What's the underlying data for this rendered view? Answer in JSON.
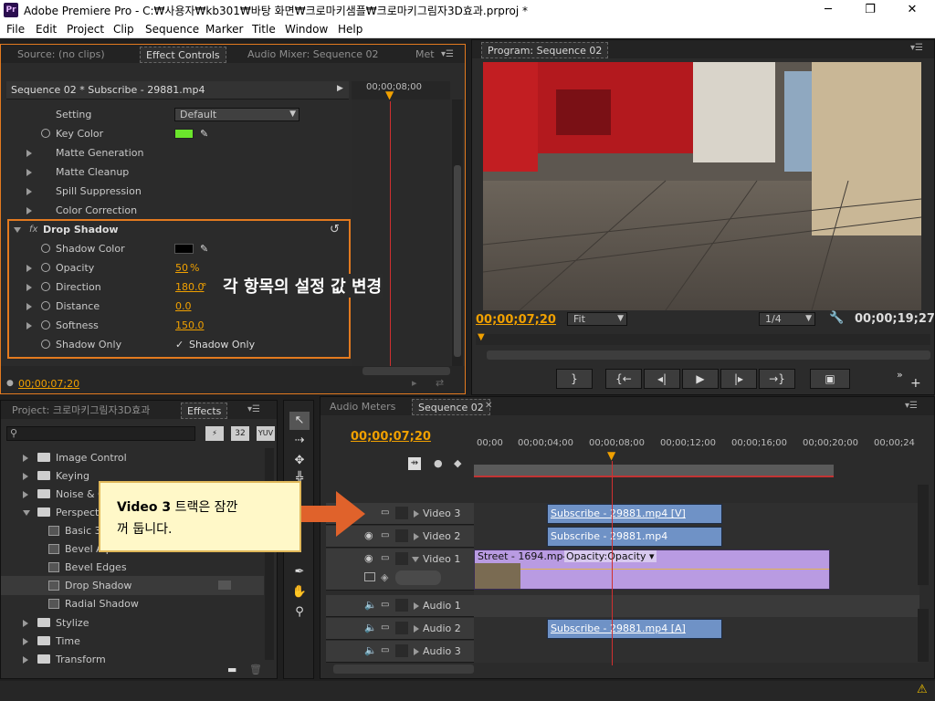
{
  "window": {
    "app_icon": "Pr",
    "title": "Adobe Premiere Pro - C:₩사용자₩kb301₩바탕 화면₩크로마키샘플₩크로마키그림자3D효과.prproj *",
    "minimize": "─",
    "maximize": "❐",
    "close": "✕"
  },
  "menu": [
    "File",
    "Edit",
    "Project",
    "Clip",
    "Sequence",
    "Marker",
    "Title",
    "Window",
    "Help"
  ],
  "top_left_panel": {
    "tabs": [
      "Source: (no clips)",
      "Effect Controls",
      "Audio Mixer: Sequence 02",
      "Met"
    ],
    "clip_header": "Sequence 02 * Subscribe - 29881.mp4",
    "ruler_time": "00;00;08;00",
    "rows": {
      "setting_label": "Setting",
      "setting_value": "Default",
      "key_color": "Key Color",
      "matte_generation": "Matte Generation",
      "matte_cleanup": "Matte Cleanup",
      "spill_suppression": "Spill Suppression",
      "color_correction": "Color Correction",
      "drop_shadow": "Drop Shadow",
      "shadow_color": "Shadow Color",
      "opacity_label": "Opacity",
      "opacity_value": "50",
      "opacity_unit": "%",
      "direction_label": "Direction",
      "direction_value": "180.0",
      "direction_unit": "°",
      "distance_label": "Distance",
      "distance_value": "0.0",
      "softness_label": "Softness",
      "softness_value": "150.0",
      "shadow_only_label": "Shadow Only",
      "shadow_only_check": "Shadow Only"
    },
    "annotation": "각 항목의 설정 값 변경",
    "current_time": "00;00;07;20",
    "colors": {
      "key_color": "#6be52c",
      "shadow_color": "#000000",
      "highlight": "#e37a1f"
    }
  },
  "program_monitor": {
    "tab": "Program: Sequence 02",
    "timecode": "00;00;07;20",
    "fit": "Fit",
    "resolution": "1/4",
    "duration": "00;00;19;27",
    "controls": [
      "mark-in",
      "step-back-edit",
      "step-back",
      "play",
      "step-forward",
      "step-forward-edit",
      "export-frame"
    ]
  },
  "project_panel": {
    "tabs": [
      "Project: 크로마키그림자3D효과",
      "Effects"
    ],
    "search_placeholder": "",
    "badges": [
      "32",
      "YUV"
    ],
    "tree": [
      {
        "label": "Image Control",
        "kind": "folder"
      },
      {
        "label": "Keying",
        "kind": "folder"
      },
      {
        "label": "Noise & G",
        "kind": "folder"
      },
      {
        "label": "Perspective",
        "kind": "folder-open"
      },
      {
        "label": "Basic 3D",
        "kind": "effect"
      },
      {
        "label": "Bevel Alpha",
        "kind": "effect"
      },
      {
        "label": "Bevel Edges",
        "kind": "effect"
      },
      {
        "label": "Drop Shadow",
        "kind": "effect"
      },
      {
        "label": "Radial Shadow",
        "kind": "effect"
      },
      {
        "label": "Stylize",
        "kind": "folder"
      },
      {
        "label": "Time",
        "kind": "folder"
      },
      {
        "label": "Transform",
        "kind": "folder"
      }
    ]
  },
  "callout": {
    "bold": "Video 3",
    "rest_line1": " 트랙은 잠깐",
    "line2": "꺼 둡니다."
  },
  "timeline": {
    "tabs": [
      "Audio Meters",
      "Sequence 02"
    ],
    "timecode": "00;00;07;20",
    "ruler": [
      "00;00",
      "00;00;04;00",
      "00;00;08;00",
      "00;00;12;00",
      "00;00;16;00",
      "00;00;20;00",
      "00;00;24"
    ],
    "tracks": {
      "video3": "Video 3",
      "video2": "Video 2",
      "video1": "Video 1",
      "audio1": "Audio 1",
      "audio2": "Audio 2",
      "audio3": "Audio 3"
    },
    "clips": {
      "v3": "Subscribe - 29881.mp4 [V]",
      "v2": "Subscribe - 29881.mp4",
      "v1": "Street - 1694.mp4",
      "v1_opacity": "Opacity:Opacity",
      "a2": "Subscribe - 29881.mp4 [A]"
    }
  }
}
